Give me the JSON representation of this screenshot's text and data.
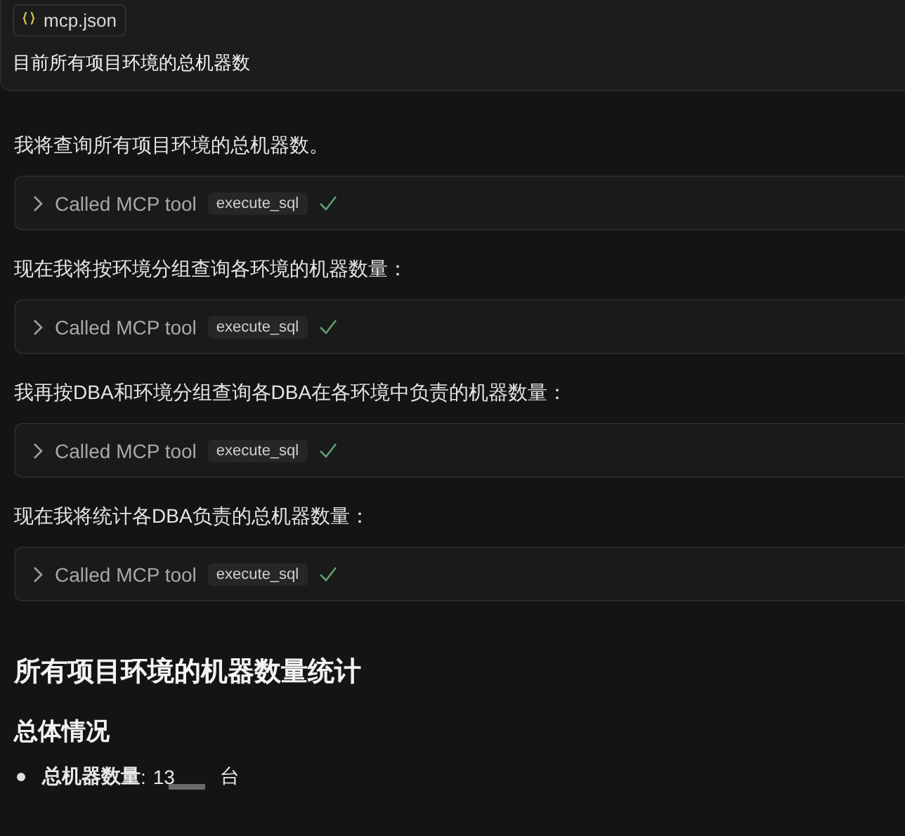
{
  "prompt_card": {
    "attachment": "mcp.json",
    "text": "目前所有项目环境的总机器数"
  },
  "messages": [
    {
      "kind": "text",
      "text": "我将查询所有项目环境的总机器数。"
    },
    {
      "kind": "tool",
      "label": "Called MCP tool",
      "tool": "execute_sql",
      "completed": true
    },
    {
      "kind": "text",
      "text": "现在我将按环境分组查询各环境的机器数量："
    },
    {
      "kind": "tool",
      "label": "Called MCP tool",
      "tool": "execute_sql",
      "completed": true
    },
    {
      "kind": "text",
      "text": "我再按DBA和环境分组查询各DBA在各环境中负责的机器数量："
    },
    {
      "kind": "tool",
      "label": "Called MCP tool",
      "tool": "execute_sql",
      "completed": true
    },
    {
      "kind": "text",
      "text": "现在我将统计各DBA负责的总机器数量："
    },
    {
      "kind": "tool",
      "label": "Called MCP tool",
      "tool": "execute_sql",
      "completed": true
    }
  ],
  "report": {
    "title": "所有项目环境的机器数量统计",
    "section": "总体情况",
    "bullets": [
      {
        "label": "总机器数量",
        "separator": ":",
        "value_start": "13",
        "value_end": "台",
        "redacted": true
      }
    ]
  }
}
